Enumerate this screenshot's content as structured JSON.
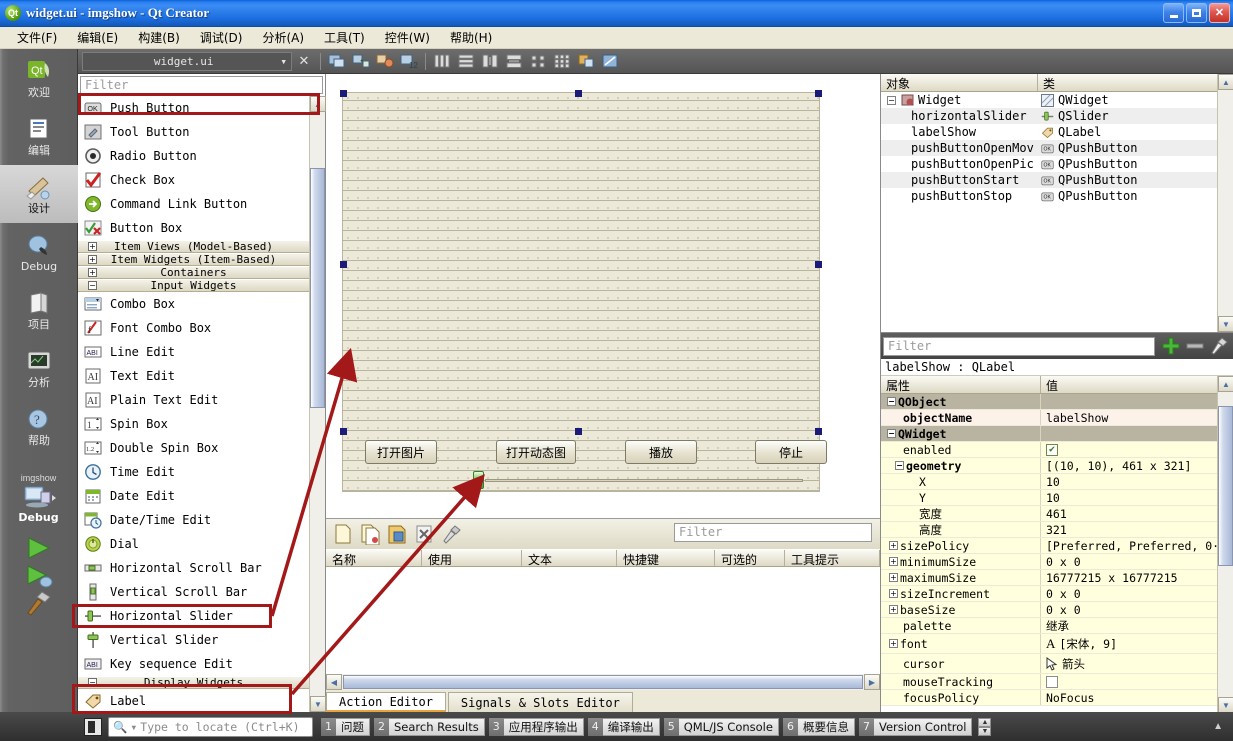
{
  "window": {
    "title": "widget.ui - imgshow - Qt Creator",
    "app_icon": "qt-logo-icon",
    "buttons": {
      "minimize": "minimize-icon",
      "maximize": "maximize-icon",
      "close": "close-icon"
    }
  },
  "menubar": {
    "items": [
      {
        "label": "文件(F)"
      },
      {
        "label": "编辑(E)"
      },
      {
        "label": "构建(B)"
      },
      {
        "label": "调试(D)"
      },
      {
        "label": "分析(A)"
      },
      {
        "label": "工具(T)"
      },
      {
        "label": "控件(W)"
      },
      {
        "label": "帮助(H)"
      }
    ]
  },
  "modebar": {
    "items": [
      {
        "label": "欢迎",
        "icon": "qt-welcome-icon",
        "active": false
      },
      {
        "label": "编辑",
        "icon": "edit-document-icon",
        "active": false
      },
      {
        "label": "设计",
        "icon": "design-brush-icon",
        "active": true
      },
      {
        "label": "Debug",
        "icon": "debug-icon",
        "active": false
      },
      {
        "label": "项目",
        "icon": "projects-folder-icon",
        "active": false
      },
      {
        "label": "分析",
        "icon": "analyze-monitor-icon",
        "active": false
      },
      {
        "label": "帮助",
        "icon": "help-question-icon",
        "active": false
      }
    ],
    "kit": {
      "project": "imgshow",
      "config": "Debug",
      "icon": "computer-icon"
    },
    "run_buttons": [
      {
        "name": "run-button",
        "icon": "play-triangle-icon"
      },
      {
        "name": "debug-run-button",
        "icon": "play-debug-icon"
      },
      {
        "name": "build-button",
        "icon": "hammer-icon"
      }
    ]
  },
  "editor_toolbar": {
    "file": "widget.ui",
    "close_label": "✕",
    "icons": [
      "edit-widgets-icon",
      "edit-signals-icon",
      "edit-buddies-icon",
      "edit-taborder-icon",
      "layout-horizontal-icon",
      "layout-vertical-icon",
      "layout-splitter-h-icon",
      "layout-splitter-v-icon",
      "layout-form-icon",
      "layout-grid-icon",
      "break-layout-icon",
      "adjust-size-icon"
    ]
  },
  "widget_box": {
    "filter_placeholder": "Filter",
    "rows": [
      {
        "type": "item",
        "label": "Push Button",
        "icon": "push-button-icon",
        "highlight": true
      },
      {
        "type": "item",
        "label": "Tool Button",
        "icon": "tool-button-icon"
      },
      {
        "type": "item",
        "label": "Radio Button",
        "icon": "radio-button-icon"
      },
      {
        "type": "item",
        "label": "Check Box",
        "icon": "check-box-icon"
      },
      {
        "type": "item",
        "label": "Command Link Button",
        "icon": "command-link-icon"
      },
      {
        "type": "item",
        "label": "Button Box",
        "icon": "button-box-icon"
      },
      {
        "type": "category",
        "label": "Item Views (Model-Based)",
        "expanded": false
      },
      {
        "type": "category",
        "label": "Item Widgets (Item-Based)",
        "expanded": false
      },
      {
        "type": "category",
        "label": "Containers",
        "expanded": false
      },
      {
        "type": "category",
        "label": "Input Widgets",
        "expanded": true
      },
      {
        "type": "item",
        "label": "Combo Box",
        "icon": "combo-box-icon"
      },
      {
        "type": "item",
        "label": "Font Combo Box",
        "icon": "font-combo-box-icon"
      },
      {
        "type": "item",
        "label": "Line Edit",
        "icon": "line-edit-icon"
      },
      {
        "type": "item",
        "label": "Text Edit",
        "icon": "text-edit-icon"
      },
      {
        "type": "item",
        "label": "Plain Text Edit",
        "icon": "plain-text-edit-icon"
      },
      {
        "type": "item",
        "label": "Spin Box",
        "icon": "spin-box-icon"
      },
      {
        "type": "item",
        "label": "Double Spin Box",
        "icon": "double-spin-box-icon"
      },
      {
        "type": "item",
        "label": "Time Edit",
        "icon": "time-edit-icon"
      },
      {
        "type": "item",
        "label": "Date Edit",
        "icon": "date-edit-icon"
      },
      {
        "type": "item",
        "label": "Date/Time Edit",
        "icon": "datetime-edit-icon"
      },
      {
        "type": "item",
        "label": "Dial",
        "icon": "dial-icon"
      },
      {
        "type": "item",
        "label": "Horizontal Scroll Bar",
        "icon": "h-scrollbar-icon"
      },
      {
        "type": "item",
        "label": "Vertical Scroll Bar",
        "icon": "v-scrollbar-icon"
      },
      {
        "type": "item",
        "label": "Horizontal Slider",
        "icon": "h-slider-icon",
        "highlight": true
      },
      {
        "type": "item",
        "label": "Vertical Slider",
        "icon": "v-slider-icon"
      },
      {
        "type": "item",
        "label": "Key sequence Edit",
        "icon": "key-sequence-edit-icon"
      },
      {
        "type": "category",
        "label": "Display Widgets",
        "expanded": true
      },
      {
        "type": "item",
        "label": "Label",
        "icon": "label-icon",
        "highlight": true
      }
    ]
  },
  "form": {
    "buttons": [
      {
        "label": "打开图片",
        "name": "open-picture-button"
      },
      {
        "label": "打开动态图",
        "name": "open-movie-button"
      },
      {
        "label": "播放",
        "name": "play-button"
      },
      {
        "label": "停止",
        "name": "stop-button"
      }
    ],
    "slider": {
      "name": "horizontal-slider",
      "value": 0
    }
  },
  "action_editor": {
    "filter_placeholder": "Filter",
    "toolbar_icons": [
      "new-action-icon",
      "copy-action-icon",
      "edit-action-icon",
      "delete-action-icon",
      "configure-icon"
    ],
    "columns": [
      "名称",
      "使用",
      "文本",
      "快捷键",
      "可选的",
      "工具提示"
    ],
    "rows": [],
    "tabs": [
      {
        "label": "Action Editor",
        "active": true
      },
      {
        "label": "Signals & Slots Editor",
        "active": false
      }
    ]
  },
  "object_inspector": {
    "columns": [
      "对象",
      "类"
    ],
    "rows": [
      {
        "object": "Widget",
        "class": "QWidget",
        "depth": 0,
        "icon": "qwidget-icon",
        "expander": "-"
      },
      {
        "object": "horizontalSlider",
        "class": "QSlider",
        "depth": 1,
        "icon": "qslider-icon"
      },
      {
        "object": "labelShow",
        "class": "QLabel",
        "depth": 1,
        "icon": "qlabel-icon"
      },
      {
        "object": "pushButtonOpenMov",
        "class": "QPushButton",
        "depth": 1,
        "icon": "qpushbutton-icon"
      },
      {
        "object": "pushButtonOpenPic",
        "class": "QPushButton",
        "depth": 1,
        "icon": "qpushbutton-icon"
      },
      {
        "object": "pushButtonStart",
        "class": "QPushButton",
        "depth": 1,
        "icon": "qpushbutton-icon"
      },
      {
        "object": "pushButtonStop",
        "class": "QPushButton",
        "depth": 1,
        "icon": "qpushbutton-icon"
      }
    ]
  },
  "property_editor": {
    "filter_placeholder": "Filter",
    "toolbar_icons": [
      "add-property-icon",
      "remove-property-icon",
      "configure-icon"
    ],
    "selected_object": "labelShow : QLabel",
    "columns": [
      "属性",
      "值"
    ],
    "rows": [
      {
        "kind": "group",
        "key": "QObject",
        "value": "",
        "expander": "-"
      },
      {
        "kind": "prop2",
        "key": "objectName",
        "value": "labelShow",
        "indent": 1,
        "bold": true
      },
      {
        "kind": "group",
        "key": "QWidget",
        "value": "",
        "expander": "-"
      },
      {
        "kind": "prop",
        "key": "enabled",
        "value": "",
        "indent": 1,
        "widget": "checkbox-checked"
      },
      {
        "kind": "prop",
        "key": "geometry",
        "value": "[(10, 10), 461 x 321]",
        "indent": 1,
        "bold": true,
        "expander": "-"
      },
      {
        "kind": "prop",
        "key": "X",
        "value": "10",
        "indent": 2
      },
      {
        "kind": "prop",
        "key": "Y",
        "value": "10",
        "indent": 2
      },
      {
        "kind": "prop",
        "key": "宽度",
        "value": "461",
        "indent": 2
      },
      {
        "kind": "prop",
        "key": "高度",
        "value": "321",
        "indent": 2
      },
      {
        "kind": "prop",
        "key": "sizePolicy",
        "value": "[Preferred, Preferred, 0···",
        "indent": 1,
        "expander": "+"
      },
      {
        "kind": "prop",
        "key": "minimumSize",
        "value": "0 x 0",
        "indent": 1,
        "expander": "+"
      },
      {
        "kind": "prop",
        "key": "maximumSize",
        "value": "16777215 x 16777215",
        "indent": 1,
        "expander": "+"
      },
      {
        "kind": "prop",
        "key": "sizeIncrement",
        "value": "0 x 0",
        "indent": 1,
        "expander": "+"
      },
      {
        "kind": "prop",
        "key": "baseSize",
        "value": "0 x 0",
        "indent": 1,
        "expander": "+"
      },
      {
        "kind": "prop",
        "key": "palette",
        "value": "继承",
        "indent": 1
      },
      {
        "kind": "prop",
        "key": "font",
        "value": "[宋体, 9]",
        "indent": 1,
        "expander": "+",
        "widget": "font-A-icon"
      },
      {
        "kind": "prop",
        "key": "cursor",
        "value": "箭头",
        "indent": 1,
        "widget": "cursor-arrow-icon"
      },
      {
        "kind": "prop",
        "key": "mouseTracking",
        "value": "",
        "indent": 1,
        "widget": "checkbox-empty"
      },
      {
        "kind": "prop",
        "key": "focusPolicy",
        "value": "NoFocus",
        "indent": 1
      }
    ]
  },
  "statusbar": {
    "locator_placeholder": "Type to locate (Ctrl+K)",
    "locator_icon": "search-icon",
    "panes": [
      {
        "num": "1",
        "label": "问题"
      },
      {
        "num": "2",
        "label": "Search Results"
      },
      {
        "num": "3",
        "label": "应用程序输出"
      },
      {
        "num": "4",
        "label": "编译输出"
      },
      {
        "num": "5",
        "label": "QML/JS Console"
      },
      {
        "num": "6",
        "label": "概要信息"
      },
      {
        "num": "7",
        "label": "Version Control"
      }
    ]
  },
  "annotations": {
    "color": "#a31818",
    "boxes": [
      "push-button-highlight",
      "horizontal-slider-highlight",
      "label-highlight"
    ],
    "arrows": [
      "slider-to-form-arrow",
      "label-to-canvas-arrow"
    ]
  }
}
